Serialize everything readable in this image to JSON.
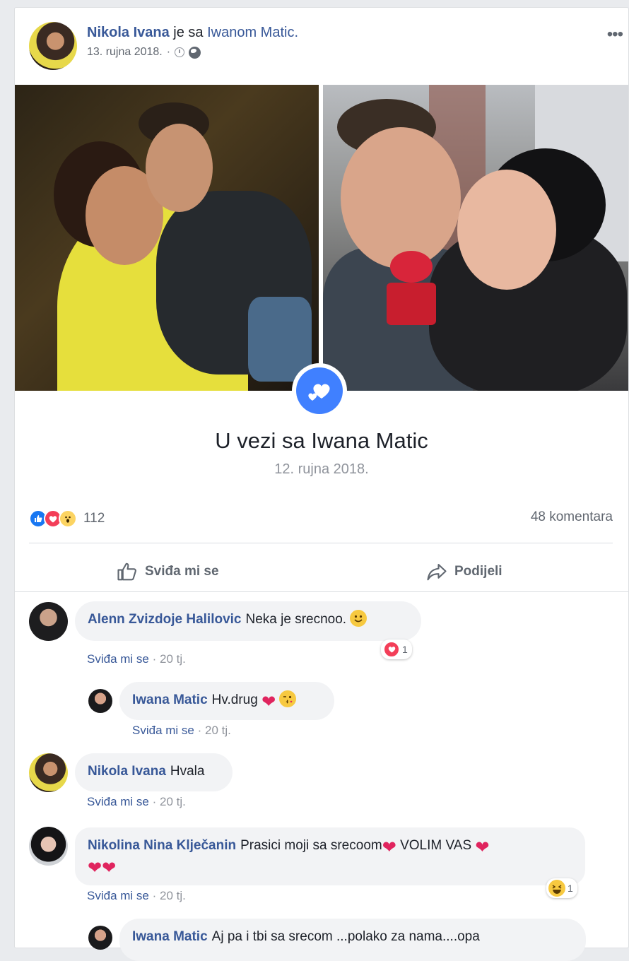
{
  "post": {
    "author": "Nikola Ivana",
    "with_text": "je sa",
    "tagged": "Iwanom Matic.",
    "date": "13. rujna 2018.",
    "separator": "·",
    "more": "•••"
  },
  "life_event": {
    "title": "U vezi sa Iwana Matic",
    "date": "12. rujna 2018."
  },
  "stats": {
    "reaction_count": "112",
    "comments": "48 komentara",
    "reactions": [
      "like-icon",
      "love-icon",
      "wow-icon"
    ]
  },
  "actions": {
    "like": "Sviđa mi se",
    "share": "Podijeli"
  },
  "comments": [
    {
      "name": "Alenn Zvizdoje Halilovic",
      "text": "Neka je srecnoo.",
      "emoji_after": [
        "smile-emoji"
      ],
      "like_label": "Sviđa mi se",
      "time": "20 tj.",
      "reaction": {
        "icon": "love-icon",
        "count": "1"
      }
    },
    {
      "name": "Iwana Matic",
      "text": "Hv.drug",
      "emoji_after": [
        "heart-emoji",
        "kiss-emoji"
      ],
      "like_label": "Sviđa mi se",
      "time": "20 tj."
    },
    {
      "name": "Nikola Ivana",
      "text": "Hvala",
      "like_label": "Sviđa mi se",
      "time": "20 tj."
    },
    {
      "name": "Nikolina Nina Klječanin",
      "text": "Prasici moji sa srecoom",
      "text2": "VOLIM VAS",
      "like_label": "Sviđa mi se",
      "time": "20 tj.",
      "reaction": {
        "icon": "haha-icon",
        "count": "1"
      }
    },
    {
      "name": "Iwana Matic",
      "text": "Aj pa i tbi sa srecom ...polako za nama....opa"
    }
  ],
  "colors": {
    "link": "#385898",
    "life_event_blue": "#4080ff",
    "page_bg": "#e9ebee"
  }
}
